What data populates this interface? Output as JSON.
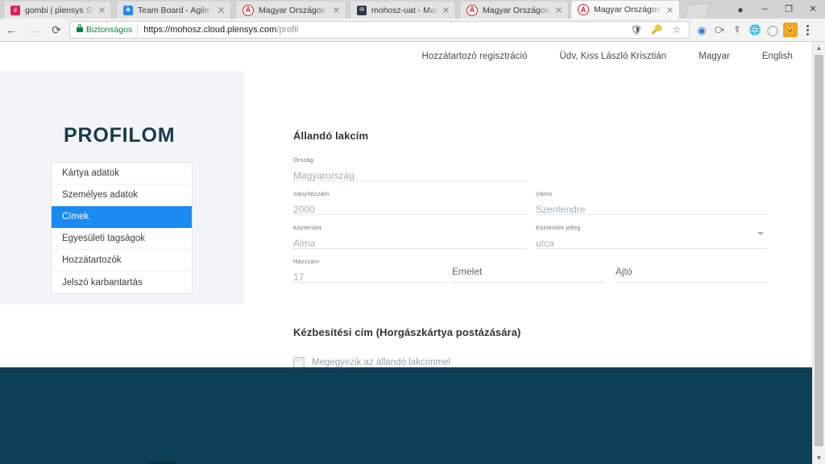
{
  "browser": {
    "tabs": [
      {
        "title": "gombi | plensys Slack",
        "favicon": "slack-icon",
        "favicon_color": "#e01e5a",
        "favicon_glyph": "#",
        "active": false
      },
      {
        "title": "Team Board - Agile Boa",
        "favicon": "jira-icon",
        "favicon_color": "#2684ff",
        "favicon_glyph": "❖",
        "active": false
      },
      {
        "title": "Magyar Országos Horg",
        "favicon": "mohosz-icon",
        "favicon_color": "#e11b22",
        "favicon_glyph": "A",
        "active": false
      },
      {
        "title": "mohosz-uat - Mailtrap",
        "favicon": "mailtrap-icon",
        "favicon_color": "#2f3a45",
        "favicon_glyph": "✉",
        "active": false
      },
      {
        "title": "Magyar Országos Horg",
        "favicon": "mohosz-icon",
        "favicon_color": "#e11b22",
        "favicon_glyph": "A",
        "active": false
      },
      {
        "title": "Magyar Országos Horg",
        "favicon": "mohosz-icon",
        "favicon_color": "#e11b22",
        "favicon_glyph": "A",
        "active": true
      }
    ],
    "window_controls": {
      "profile": "●",
      "minimize": "─",
      "maximize": "❐",
      "close": "✕"
    },
    "toolbar": {
      "back": "←",
      "forward": "→",
      "reload": "⟳",
      "security_label": "Biztonságos",
      "url_domain": "https://mohosz.cloud.plensys.com",
      "url_path": "/profil",
      "omnibox_icons": [
        "shield-icon",
        "key-icon",
        "star-icon"
      ],
      "extension_icons": [
        "sync-icon",
        "cluster-icon",
        "pocket-icon",
        "globe-icon",
        "circle-icon",
        "cat-icon"
      ],
      "menu": "kebab-menu-icon"
    }
  },
  "page": {
    "header_links": [
      "Hozzátartozó regisztráció",
      "Üdv, Kiss László Krisztián",
      "Magyar",
      "English"
    ],
    "sidebar": {
      "title": "PROFILOM",
      "items": [
        {
          "label": "Kártya adatok",
          "active": false
        },
        {
          "label": "Személyes adatok",
          "active": false
        },
        {
          "label": "Címek",
          "active": true
        },
        {
          "label": "Egyesületi tagságok",
          "active": false
        },
        {
          "label": "Hozzátartozók",
          "active": false
        },
        {
          "label": "Jelszó karbantartás",
          "active": false
        }
      ],
      "accent_color": "#1b8af2",
      "panel_color": "#f4f5f9"
    },
    "permanent_address": {
      "section_title": "Állandó lakcím",
      "fields": {
        "country": {
          "label": "Ország",
          "value": "Magyarország"
        },
        "postal_code": {
          "label": "Irányítószám",
          "value": "2000"
        },
        "city": {
          "label": "Város",
          "value": "Szentendre"
        },
        "public_area": {
          "label": "Közterület",
          "value": "Alma"
        },
        "area_type": {
          "label": "Közterület jelleg",
          "value": "utca"
        },
        "house_number": {
          "label": "Házszám",
          "value": "17"
        },
        "floor": {
          "label": "",
          "placeholder": "Emelet",
          "value": ""
        },
        "door": {
          "label": "",
          "placeholder": "Ajtó",
          "value": ""
        }
      }
    },
    "delivery_address": {
      "section_title": "Kézbesítési cím (Horgászkártya postázására)",
      "same_as_permanent": {
        "label": "Megegyezik az állandó lakcímmel",
        "checked": true,
        "disabled": true
      }
    },
    "footer_color": "#0d3f56"
  }
}
